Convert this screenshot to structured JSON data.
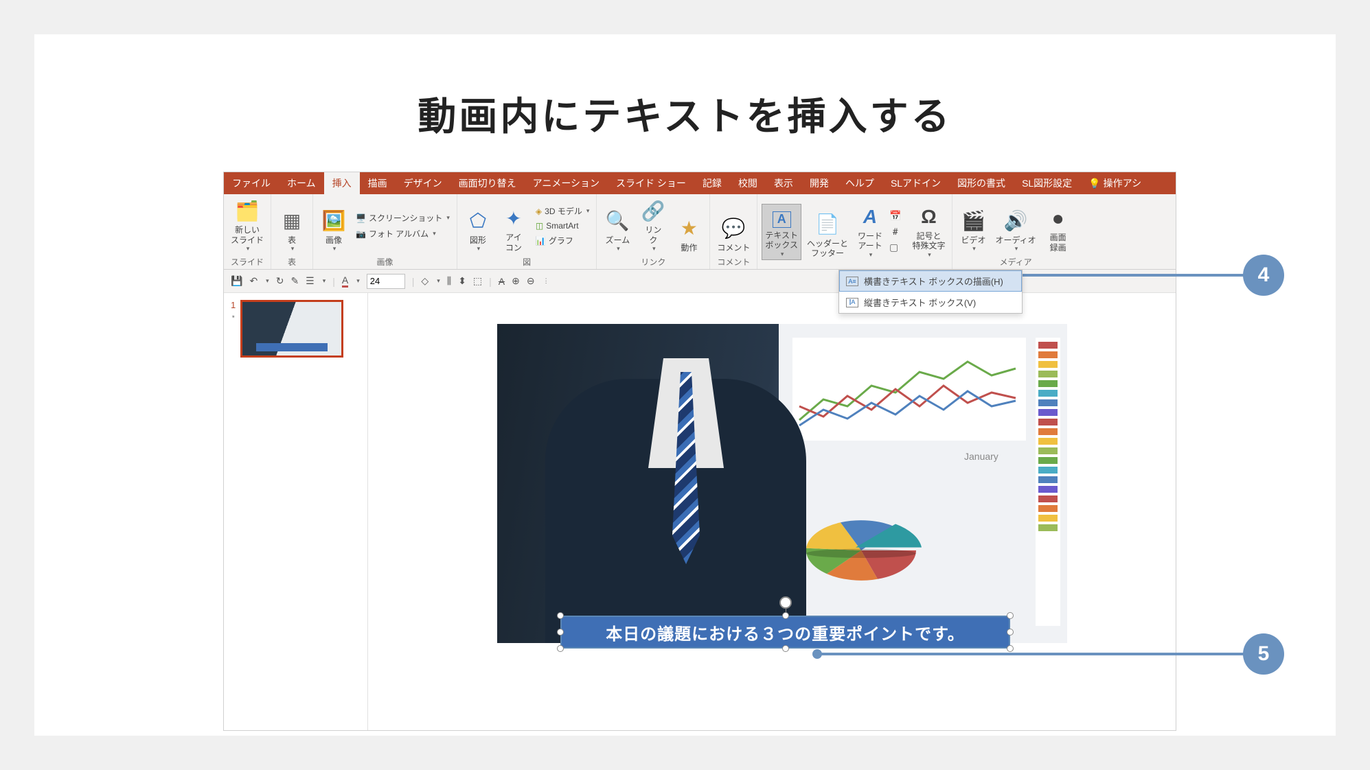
{
  "page_title": "動画内にテキストを挿入する",
  "callouts": {
    "c4": "4",
    "c5": "5"
  },
  "tabs": {
    "file": "ファイル",
    "home": "ホーム",
    "insert": "挿入",
    "draw": "描画",
    "design": "デザイン",
    "transition": "画面切り替え",
    "animation": "アニメーション",
    "slideshow": "スライド ショー",
    "record": "記録",
    "review": "校閲",
    "view": "表示",
    "developer": "開発",
    "help": "ヘルプ",
    "sladdin": "SLアドイン",
    "shape_format": "図形の書式",
    "sl_shape": "SL図形設定",
    "tell_me": "操作アシ"
  },
  "ribbon": {
    "slides": {
      "new_slide": "新しい\nスライド",
      "group": "スライド"
    },
    "tables": {
      "table": "表",
      "group": "表"
    },
    "images": {
      "picture": "画像",
      "screenshot": "スクリーンショット",
      "photo_album": "フォト アルバム",
      "group": "画像"
    },
    "illustrations": {
      "shapes": "図形",
      "icons": "アイ\nコン",
      "models": "3D モデル",
      "smartart": "SmartArt",
      "chart": "グラフ",
      "group": "図"
    },
    "links": {
      "zoom": "ズーム",
      "link": "リン\nク",
      "action": "動作",
      "group": "リンク"
    },
    "comments": {
      "comment": "コメント",
      "group": "コメント"
    },
    "text": {
      "textbox": "テキスト\nボックス",
      "header_footer": "ヘッダーと\nフッター",
      "wordart": "ワード\nアート"
    },
    "symbols": {
      "symbol": "記号と\n特殊文字"
    },
    "media": {
      "video": "ビデオ",
      "audio": "オーディオ",
      "screen_rec": "画面\n録画",
      "group": "メディア"
    }
  },
  "dropdown": {
    "horizontal": "横書きテキスト ボックスの描画(H)",
    "vertical": "縦書きテキスト ボックス(V)"
  },
  "qat": {
    "font_size": "24"
  },
  "thumb": {
    "num": "1",
    "star": "⋆"
  },
  "textbox_content": "本日の議題における３つの重要ポイントです。",
  "screen_label": "January",
  "chart_data": {
    "line_chart": {
      "type": "line",
      "x_points": 10,
      "series": [
        {
          "name": "green",
          "color": "#6aaa4a",
          "values": [
            20,
            40,
            30,
            55,
            45,
            70,
            60,
            80,
            65,
            75
          ]
        },
        {
          "name": "red",
          "color": "#c0504d",
          "values": [
            35,
            25,
            45,
            30,
            50,
            35,
            55,
            40,
            50,
            45
          ]
        },
        {
          "name": "blue",
          "color": "#4f81bd",
          "values": [
            15,
            30,
            20,
            35,
            25,
            40,
            30,
            45,
            35,
            40
          ]
        }
      ],
      "ylim": [
        0,
        100
      ]
    },
    "pie_chart": {
      "type": "pie",
      "slices": [
        {
          "label": "teal",
          "value": 25,
          "color": "#2e9aa1"
        },
        {
          "label": "blue",
          "value": 20,
          "color": "#4f81bd"
        },
        {
          "label": "yellow",
          "value": 15,
          "color": "#f0c040"
        },
        {
          "label": "green",
          "value": 15,
          "color": "#6aaa4a"
        },
        {
          "label": "orange",
          "value": 15,
          "color": "#e07b3c"
        },
        {
          "label": "red",
          "value": 10,
          "color": "#c0504d"
        }
      ]
    },
    "side_bars": {
      "type": "bar",
      "colors": [
        "#c0504d",
        "#e07b3c",
        "#f0c040",
        "#9bbb59",
        "#6aaa4a",
        "#4aacc5",
        "#4f81bd",
        "#6a5acd",
        "#c0504d",
        "#e07b3c",
        "#f0c040",
        "#9bbb59",
        "#6aaa4a",
        "#4aacc5",
        "#4f81bd",
        "#6a5acd",
        "#c0504d",
        "#e07b3c",
        "#f0c040",
        "#9bbb59"
      ]
    }
  }
}
